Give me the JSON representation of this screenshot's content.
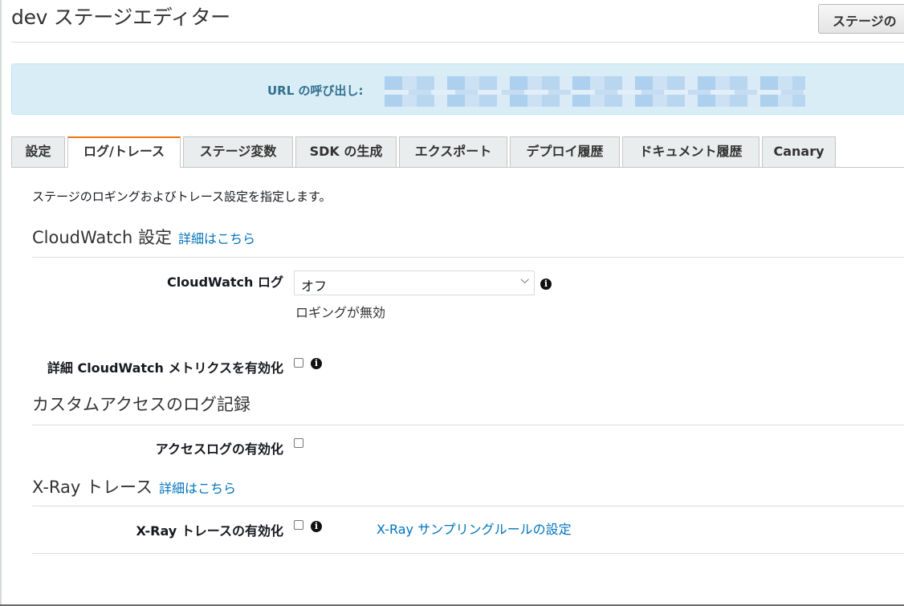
{
  "header": {
    "title": "dev ステージエディター",
    "button_label": "ステージの"
  },
  "invoke_url": {
    "label": "URL の呼び出し:"
  },
  "tabs": [
    {
      "label": "設定"
    },
    {
      "label": "ログ/トレース"
    },
    {
      "label": "ステージ変数"
    },
    {
      "label": "SDK の生成"
    },
    {
      "label": "エクスポート"
    },
    {
      "label": "デプロイ履歴"
    },
    {
      "label": "ドキュメント履歴"
    },
    {
      "label": "Canary"
    }
  ],
  "active_tab": "ログ/トレース",
  "description": "ステージのロギングおよびトレース設定を指定します。",
  "cloudwatch": {
    "title": "CloudWatch 設定",
    "link": "詳細はこちら",
    "log_label": "CloudWatch ログ",
    "log_value": "オフ",
    "log_helper": "ロギングが無効",
    "metrics_label": "詳細 CloudWatch メトリクスを有効化",
    "metrics_checked": false
  },
  "access_log": {
    "title": "カスタムアクセスのログ記録",
    "label": "アクセスログの有効化",
    "checked": false
  },
  "xray": {
    "title": "X-Ray トレース",
    "link": "詳細はこちら",
    "label": "X-Ray トレースの有効化",
    "checked": false,
    "sampling_link": "X-Ray サンプリングルールの設定"
  },
  "colors": {
    "accent_tab": "#ec7211",
    "link": "#0073bb",
    "info_bg": "#d9edf7",
    "info_text": "#31708f"
  },
  "icons": [
    "info-icon",
    "chevron-down-icon"
  ]
}
